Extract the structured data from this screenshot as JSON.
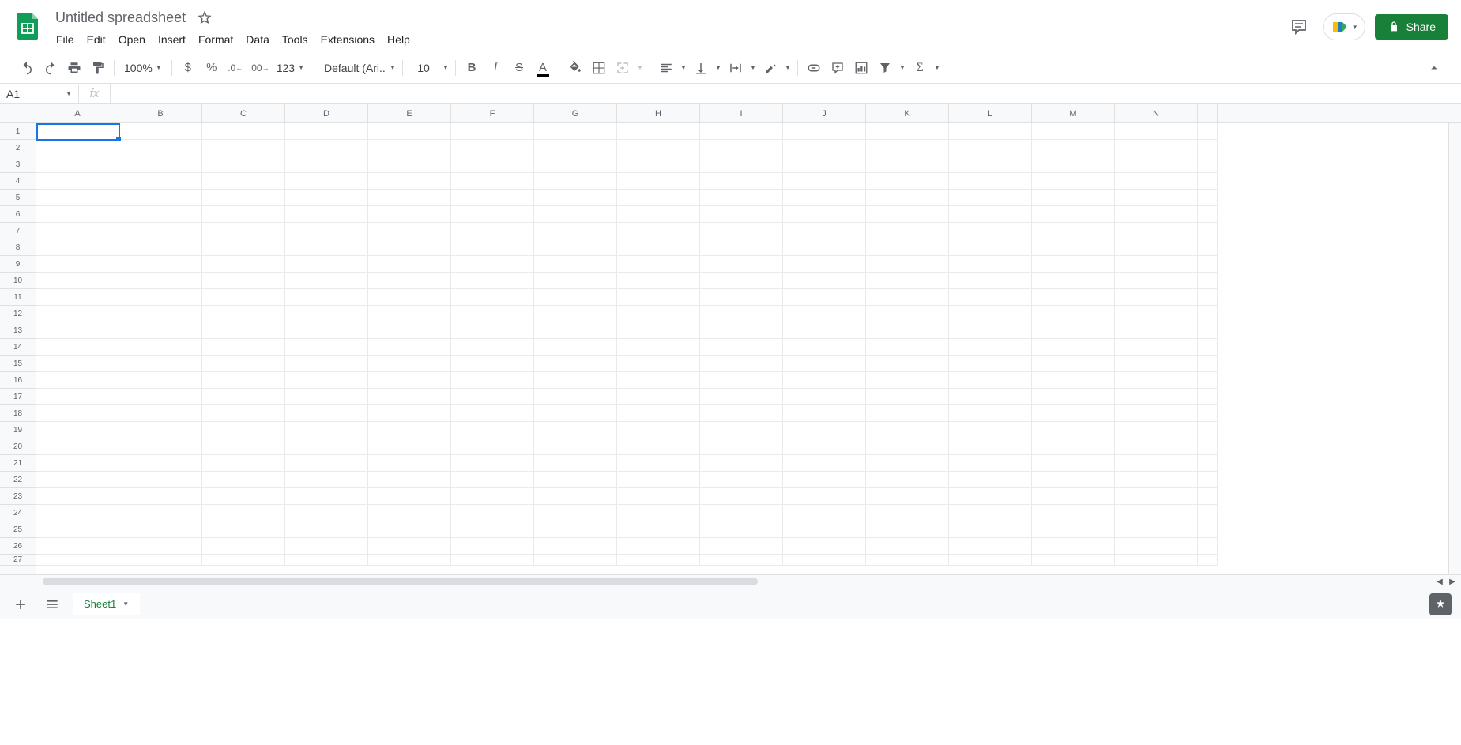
{
  "header": {
    "title": "Untitled spreadsheet",
    "menus": [
      "File",
      "Edit",
      "Open",
      "Insert",
      "Format",
      "Data",
      "Tools",
      "Extensions",
      "Help"
    ],
    "share_label": "Share"
  },
  "toolbar": {
    "zoom": "100%",
    "currency_format": "$",
    "percent_format": "%",
    "decrease_decimal": ".0",
    "increase_decimal": ".00",
    "more_formats": "123",
    "font_name": "Default (Ari...",
    "font_size": "10"
  },
  "formula_bar": {
    "name_box": "A1",
    "fx_label": "fx",
    "formula_value": ""
  },
  "grid": {
    "columns": [
      "A",
      "B",
      "C",
      "D",
      "E",
      "F",
      "G",
      "H",
      "I",
      "J",
      "K",
      "L",
      "M",
      "N"
    ],
    "rows": [
      "1",
      "2",
      "3",
      "4",
      "5",
      "6",
      "7",
      "8",
      "9",
      "10",
      "11",
      "12",
      "13",
      "14",
      "15",
      "16",
      "17",
      "18",
      "19",
      "20",
      "21",
      "22",
      "23",
      "24",
      "25",
      "26",
      "27"
    ],
    "active_cell": "A1"
  },
  "sheets": {
    "active": "Sheet1"
  }
}
